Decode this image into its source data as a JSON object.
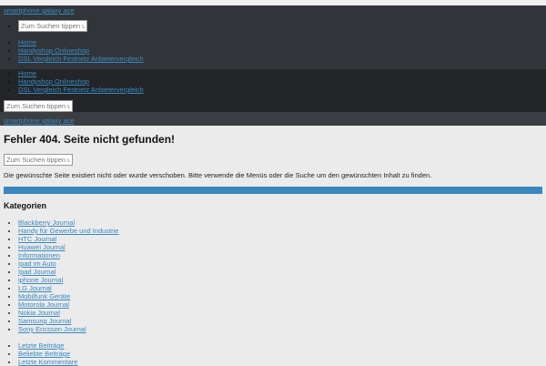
{
  "header": {
    "site_link": "smartphone galaxy ace",
    "search_placeholder": "Zum Suchen tippen und",
    "nav": [
      "Home",
      "Handyshop Onlineshop",
      "DSL Vergleich Festnetz Anbietervergleich"
    ]
  },
  "main": {
    "title": "Fehler 404. Seite nicht gefunden!",
    "search_placeholder": "Zum Suchen tippen und",
    "message": "Die gewünschte Seite existiert nicht oder wurde verschoben. Bitte verwende die Menüs oder die Suche um den gewünschten Inhalt zu finden.",
    "categories_title": "Kategorien",
    "categories": [
      "Blackberry Journal",
      "Handy für Gewerbe und Industrie",
      "HTC Journal",
      "Huawei Journal",
      "Informationen",
      "Ipad im Auto",
      "Ipad Journal",
      "iphone Journal",
      "LG Journal",
      "Mobilfunk Geräte",
      "Motorola Journal",
      "Nokia Journal",
      "Samsung Journal",
      "Sony Ericsson Journal"
    ],
    "tabs": [
      "Letzte Beiträge",
      "Beliebte Beiträge",
      "Letzte Kommentare"
    ]
  }
}
